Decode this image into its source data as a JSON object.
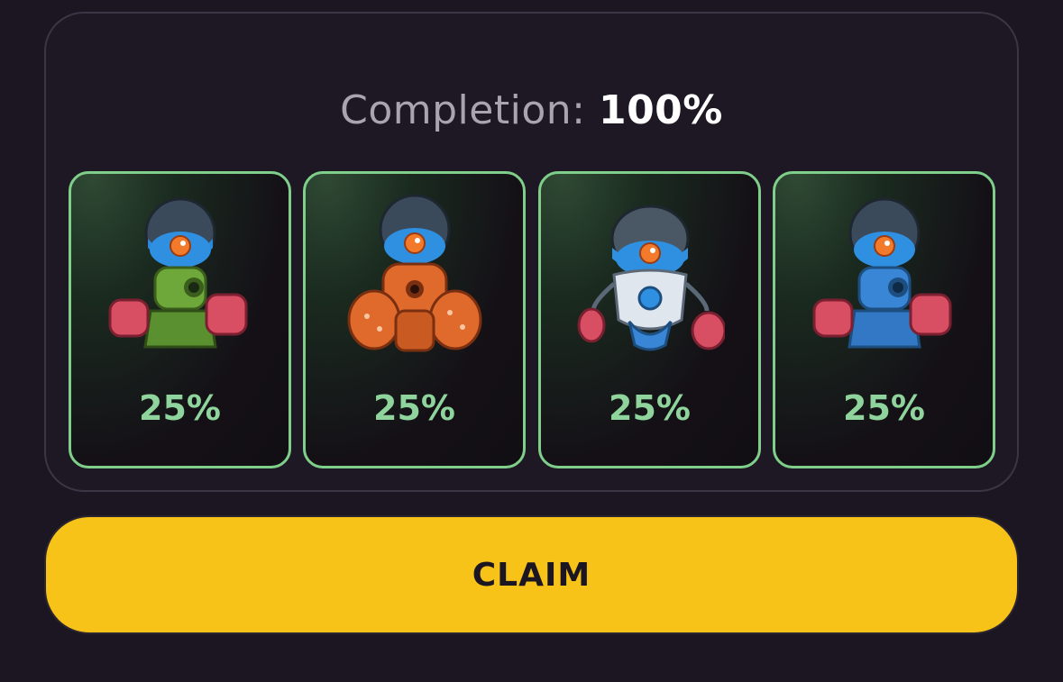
{
  "completion": {
    "label": "Completion:",
    "value": "100%",
    "fraction": 1.0
  },
  "cards": [
    {
      "percent": "25%",
      "robot": "robot-green-icon",
      "color": "#6ea83a"
    },
    {
      "percent": "25%",
      "robot": "robot-orange-icon",
      "color": "#e06a2c"
    },
    {
      "percent": "25%",
      "robot": "robot-white-blue-icon",
      "color": "#dfe6ee"
    },
    {
      "percent": "25%",
      "robot": "robot-blue-icon",
      "color": "#3a86d6"
    }
  ],
  "claim": {
    "label": "CLAIM"
  },
  "colors": {
    "accent_green": "#8fd49c",
    "card_border": "#7fcf8a",
    "button": "#f8c318",
    "background": "#1b1621"
  }
}
